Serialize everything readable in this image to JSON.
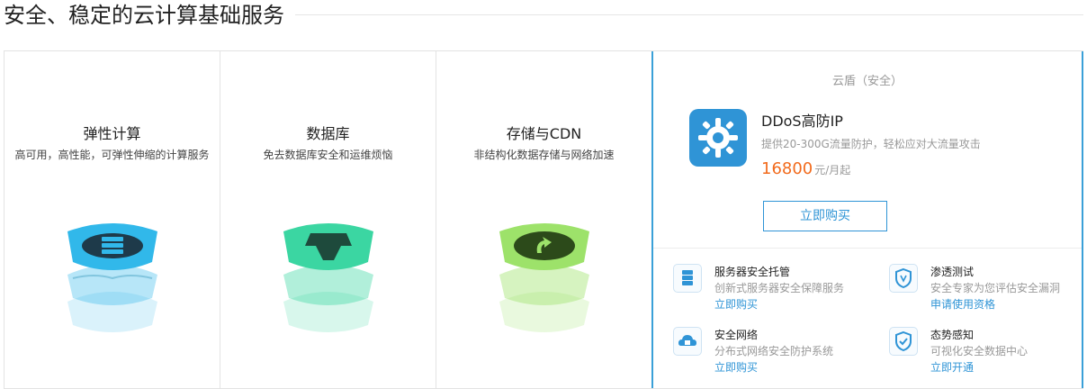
{
  "header": {
    "title": "安全、稳定的云计算基础服务"
  },
  "cards": [
    {
      "title": "弹性计算",
      "subtitle": "高可用，高性能，可弹性伸缩的计算服务",
      "color": "#31b8ea"
    },
    {
      "title": "数据库",
      "subtitle": "免去数据库安全和运维烦恼",
      "color": "#3bd6a2"
    },
    {
      "title": "存储与CDN",
      "subtitle": "非结构化数据存储与网络加速",
      "color": "#9de26a"
    }
  ],
  "feature": {
    "category": "云盾（安全）",
    "product": {
      "name": "DDoS高防IP",
      "description": "提供20-300G流量防护，轻松应对大流量攻击",
      "price": "16800",
      "price_unit": "元/月起",
      "buy_label": "立即购买",
      "icon": "gear-shield-icon"
    },
    "services": [
      {
        "name": "服务器安全托管",
        "description": "创新式服务器安全保障服务",
        "link": "立即购买",
        "icon": "server-icon"
      },
      {
        "name": "渗透测试",
        "description": "安全专家为您评估安全漏洞",
        "link": "申请使用资格",
        "icon": "shield-icon"
      },
      {
        "name": "安全网络",
        "description": "分布式网络安全防护系统",
        "link": "立即购买",
        "icon": "cloud-lock-icon"
      },
      {
        "name": "态势感知",
        "description": "可视化安全数据中心",
        "link": "立即开通",
        "icon": "shield-check-icon"
      }
    ]
  },
  "colors": {
    "accent": "#2f94d6",
    "price": "#f26b1d",
    "border": "#3aa0d8"
  }
}
